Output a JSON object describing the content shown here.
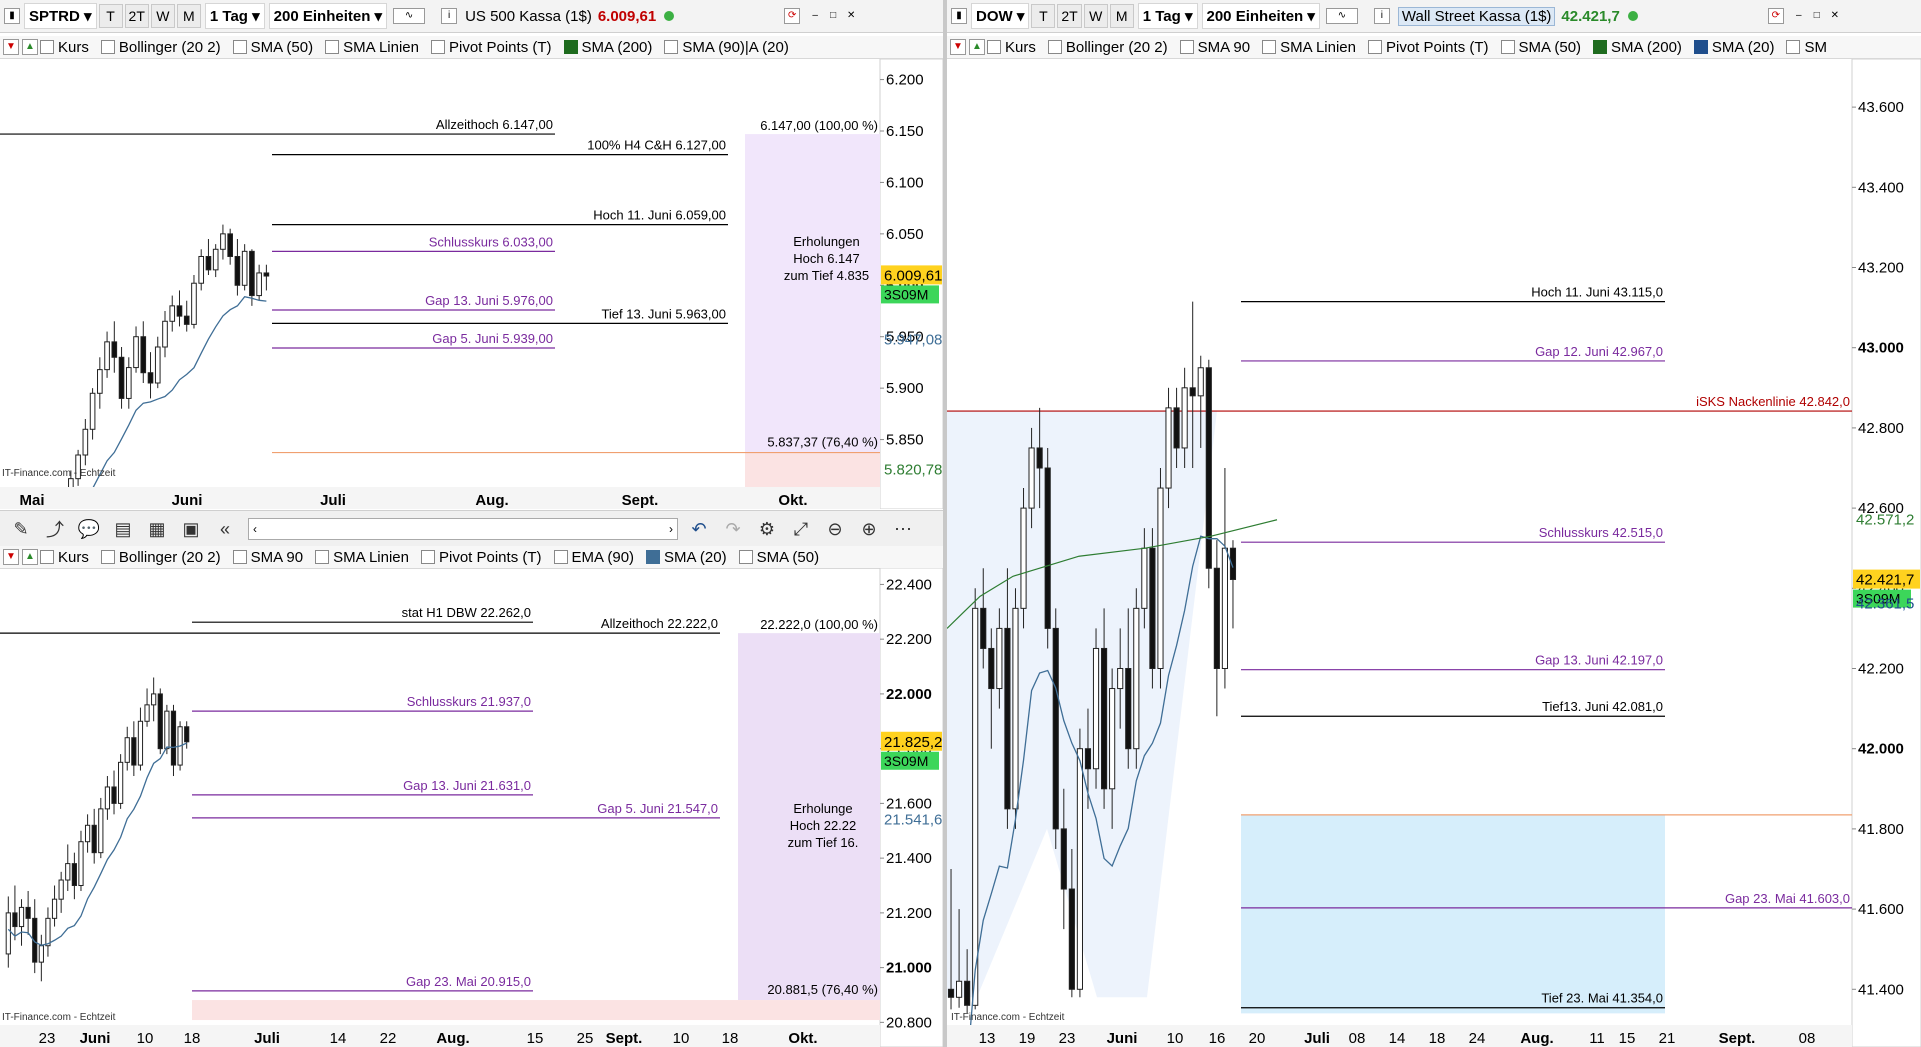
{
  "left_top": {
    "toolbar": {
      "symbol": "SPTRD",
      "periods": [
        "T",
        "2T",
        "W",
        "M"
      ],
      "interval": "1 Tag",
      "units": "200 Einheiten",
      "title": "US 500 Kassa (1$)",
      "price": "6.009,61"
    },
    "indicators": [
      "Kurs",
      "Bollinger (20 2)",
      "SMA (50)",
      "SMA Linien",
      "Pivot Points (T)",
      "SMA (200)",
      "SMA (90)|A (20)"
    ],
    "watermark": "IT-Finance.com - Echtzeit",
    "x_labels": [
      "Mai",
      "Juni",
      "Juli",
      "Aug.",
      "Sept.",
      "Okt."
    ]
  },
  "left_bottom": {
    "indicators": [
      "Kurs",
      "Bollinger (20 2)",
      "SMA 90",
      "SMA Linien",
      "Pivot Points (T)",
      "EMA (90)",
      "SMA (20)",
      "SMA (50)"
    ],
    "watermark": "IT-Finance.com - Echtzeit",
    "x_labels": [
      "23",
      "Juni",
      "10",
      "18",
      "Juli",
      "14",
      "22",
      "Aug.",
      "15",
      "25",
      "Sept.",
      "10",
      "18",
      "Okt."
    ]
  },
  "right": {
    "toolbar": {
      "symbol": "DOW",
      "periods": [
        "T",
        "2T",
        "W",
        "M"
      ],
      "interval": "1 Tag",
      "units": "200 Einheiten",
      "title": "Wall Street Kassa (1$)",
      "price": "42.421,7"
    },
    "indicators": [
      "Kurs",
      "Bollinger (20 2)",
      "SMA 90",
      "SMA Linien",
      "Pivot Points (T)",
      "SMA (50)",
      "SMA (200)",
      "SMA (20)",
      "SM"
    ],
    "watermark": "IT-Finance.com - Echtzeit",
    "x_labels": [
      "13",
      "19",
      "23",
      "Juni",
      "10",
      "16",
      "20",
      "Juli",
      "08",
      "14",
      "18",
      "24",
      "Aug.",
      "11",
      "15",
      "21",
      "Sept.",
      "08"
    ]
  },
  "chart_data": [
    {
      "type": "candlestick",
      "title": "US 500 Kassa (1$)",
      "ylim": [
        5800,
        6220
      ],
      "y_ticks": [
        "6.200",
        "6.150",
        "6.100",
        "6.050",
        "6.000",
        "5.950",
        "5.900",
        "5.850"
      ],
      "last_price": "6.009,61",
      "timer": "3S09M",
      "axis_markers": [
        "5.947,08",
        "5.820,78"
      ],
      "levels": [
        {
          "label": "Allzeithoch  6.147,00",
          "value": 6147,
          "color": "#000000"
        },
        {
          "label": "100% H4 C&H  6.127,00",
          "value": 6127,
          "color": "#000000"
        },
        {
          "label": "Hoch 11. Juni 6.059,00",
          "value": 6059,
          "color": "#000000"
        },
        {
          "label": "Schlusskurs 6.033,00",
          "value": 6033,
          "color": "#7a2a9e"
        },
        {
          "label": "Gap 13. Juni 5.976,00",
          "value": 5976,
          "color": "#7a2a9e"
        },
        {
          "label": "Tief 13. Juni 5.963,00",
          "value": 5963,
          "color": "#000000"
        },
        {
          "label": "Gap 5. Juni 5.939,00",
          "value": 5939,
          "color": "#7a2a9e"
        }
      ],
      "fib_labels": [
        "6.147,00 (100,00 %)",
        "5.837,37 (76,40 %)"
      ],
      "box_text": [
        "Erholungen",
        "Hoch 6.147",
        "zum Tief 4.835"
      ],
      "candles": [
        [
          5760,
          5790,
          5750,
          5785
        ],
        [
          5785,
          5820,
          5780,
          5812
        ],
        [
          5812,
          5840,
          5805,
          5835
        ],
        [
          5835,
          5870,
          5825,
          5860
        ],
        [
          5860,
          5900,
          5850,
          5895
        ],
        [
          5895,
          5930,
          5880,
          5918
        ],
        [
          5918,
          5955,
          5910,
          5945
        ],
        [
          5945,
          5965,
          5915,
          5930
        ],
        [
          5930,
          5940,
          5880,
          5890
        ],
        [
          5890,
          5930,
          5880,
          5920
        ],
        [
          5920,
          5960,
          5915,
          5950
        ],
        [
          5950,
          5965,
          5905,
          5915
        ],
        [
          5915,
          5935,
          5890,
          5905
        ],
        [
          5905,
          5950,
          5900,
          5940
        ],
        [
          5940,
          5975,
          5930,
          5965
        ],
        [
          5965,
          5990,
          5955,
          5980
        ],
        [
          5980,
          5995,
          5960,
          5970
        ],
        [
          5970,
          5985,
          5955,
          5962
        ],
        [
          5962,
          6010,
          5958,
          6002
        ],
        [
          6002,
          6035,
          5995,
          6028
        ],
        [
          6028,
          6045,
          6010,
          6015
        ],
        [
          6015,
          6040,
          6008,
          6035
        ],
        [
          6035,
          6059,
          6025,
          6050
        ],
        [
          6050,
          6055,
          6020,
          6028
        ],
        [
          6028,
          6045,
          5990,
          6000
        ],
        [
          6000,
          6040,
          5995,
          6033
        ],
        [
          6033,
          6035,
          5980,
          5990
        ],
        [
          5990,
          6020,
          5985,
          6012
        ],
        [
          6012,
          6020,
          5995,
          6009
        ]
      ]
    },
    {
      "type": "candlestick",
      "title": "",
      "ylim": [
        20780,
        22460
      ],
      "y_ticks": [
        "22.400",
        "22.200",
        "22.000",
        "21.800",
        "21.600",
        "21.400",
        "21.200",
        "21.000",
        "20.800"
      ],
      "last_price": "21.825,2",
      "timer": "3S09M",
      "axis_markers": [
        "21.541,6"
      ],
      "levels": [
        {
          "label": "stat H1 DBW 22.262,0",
          "value": 22262,
          "color": "#000000"
        },
        {
          "label": "Allzeithoch 22.222,0",
          "value": 22222,
          "color": "#000000"
        },
        {
          "label": "Schlusskurs 21.937,0",
          "value": 21937,
          "color": "#7a2a9e"
        },
        {
          "label": "Gap 13. Juni 21.631,0",
          "value": 21631,
          "color": "#7a2a9e"
        },
        {
          "label": "Gap 5. Juni 21.547,0",
          "value": 21547,
          "color": "#7a2a9e"
        },
        {
          "label": "Gap 23. Mai 20.915,0",
          "value": 20915,
          "color": "#7a2a9e"
        }
      ],
      "fib_labels": [
        "22.222,0 (100,00 %)",
        "20.881,5 (76,40 %)"
      ],
      "box_text": [
        "Erholunge",
        "Hoch 22.22",
        "zum Tief 16."
      ],
      "candles": [
        [
          21050,
          21260,
          21000,
          21200
        ],
        [
          21200,
          21300,
          21100,
          21150
        ],
        [
          21150,
          21250,
          21080,
          21220
        ],
        [
          21220,
          21280,
          21120,
          21180
        ],
        [
          21180,
          21250,
          20980,
          21020
        ],
        [
          21020,
          21120,
          20950,
          21080
        ],
        [
          21080,
          21220,
          21040,
          21180
        ],
        [
          21180,
          21300,
          21150,
          21250
        ],
        [
          21250,
          21350,
          21200,
          21320
        ],
        [
          21320,
          21450,
          21280,
          21380
        ],
        [
          21380,
          21420,
          21250,
          21300
        ],
        [
          21300,
          21500,
          21280,
          21460
        ],
        [
          21460,
          21560,
          21420,
          21520
        ],
        [
          21520,
          21580,
          21380,
          21420
        ],
        [
          21420,
          21620,
          21400,
          21580
        ],
        [
          21580,
          21700,
          21540,
          21660
        ],
        [
          21660,
          21720,
          21560,
          21600
        ],
        [
          21600,
          21780,
          21580,
          21750
        ],
        [
          21750,
          21880,
          21720,
          21840
        ],
        [
          21840,
          21900,
          21700,
          21740
        ],
        [
          21740,
          21950,
          21720,
          21900
        ],
        [
          21900,
          22020,
          21880,
          21960
        ],
        [
          21960,
          22060,
          21900,
          22000
        ],
        [
          22000,
          22020,
          21780,
          21800
        ],
        [
          21800,
          21960,
          21780,
          21937
        ],
        [
          21937,
          21960,
          21700,
          21740
        ],
        [
          21740,
          21900,
          21720,
          21880
        ],
        [
          21880,
          21900,
          21800,
          21825
        ]
      ]
    },
    {
      "type": "candlestick",
      "title": "Wall Street Kassa (1$)",
      "ylim": [
        41330,
        43720
      ],
      "y_ticks": [
        "43.600",
        "43.400",
        "43.200",
        "43.000",
        "42.800",
        "42.600",
        "42.400",
        "42.200",
        "42.000",
        "41.800",
        "41.600",
        "41.400"
      ],
      "last_price": "42.421,7",
      "timer": "3S09M",
      "axis_markers": [
        "42.571,2",
        "42.361,5"
      ],
      "levels": [
        {
          "label": "Hoch 11. Juni 43.115,0",
          "value": 43115,
          "color": "#000000"
        },
        {
          "label": "Gap 12. Juni 42.967,0",
          "value": 42967,
          "color": "#7a2a9e"
        },
        {
          "label": "iSKS Nackenlinie 42.842,0",
          "value": 42842,
          "color": "#b00000"
        },
        {
          "label": "Schlusskurs 42.515,0",
          "value": 42515,
          "color": "#7a2a9e"
        },
        {
          "label": "Gap 13. Juni 42.197,0",
          "value": 42197,
          "color": "#7a2a9e"
        },
        {
          "label": "Tief13. Juni 42.081,0",
          "value": 42081,
          "color": "#000000"
        },
        {
          "label": "Gap  23. Mai 41.603,0",
          "value": 41603,
          "color": "#7a2a9e"
        },
        {
          "label": "Tief  23. Mai 41.354,0",
          "value": 41354,
          "color": "#000000"
        }
      ],
      "candles": [
        [
          41400,
          41700,
          41350,
          41380
        ],
        [
          41380,
          41600,
          41354,
          41420
        ],
        [
          41420,
          41500,
          41340,
          41360
        ],
        [
          41360,
          42400,
          41350,
          42350
        ],
        [
          42350,
          42450,
          42200,
          42250
        ],
        [
          42250,
          42300,
          42000,
          42150
        ],
        [
          42150,
          42350,
          42100,
          42300
        ],
        [
          42300,
          42450,
          41800,
          41850
        ],
        [
          41850,
          42400,
          41800,
          42350
        ],
        [
          42350,
          42650,
          42300,
          42600
        ],
        [
          42600,
          42800,
          42550,
          42750
        ],
        [
          42750,
          42850,
          42600,
          42700
        ],
        [
          42700,
          42750,
          42250,
          42300
        ],
        [
          42300,
          42350,
          41750,
          41800
        ],
        [
          41800,
          41900,
          41550,
          41650
        ],
        [
          41650,
          41750,
          41380,
          41400
        ],
        [
          41400,
          42050,
          41380,
          42000
        ],
        [
          42000,
          42100,
          41850,
          41950
        ],
        [
          41950,
          42300,
          41900,
          42250
        ],
        [
          42250,
          42350,
          41850,
          41900
        ],
        [
          41900,
          42200,
          41800,
          42150
        ],
        [
          42150,
          42300,
          42050,
          42200
        ],
        [
          42200,
          42350,
          41950,
          42000
        ],
        [
          42000,
          42400,
          41950,
          42350
        ],
        [
          42350,
          42550,
          42300,
          42500
        ],
        [
          42500,
          42550,
          42150,
          42200
        ],
        [
          42200,
          42700,
          42150,
          42650
        ],
        [
          42650,
          42900,
          42600,
          42850
        ],
        [
          42850,
          42900,
          42700,
          42750
        ],
        [
          42750,
          42950,
          42700,
          42900
        ],
        [
          42900,
          43115,
          42700,
          42880
        ],
        [
          42880,
          42980,
          42750,
          42950
        ],
        [
          42950,
          42970,
          42400,
          42450
        ],
        [
          42450,
          42520,
          42081,
          42200
        ],
        [
          42200,
          42700,
          42150,
          42500
        ],
        [
          42500,
          42520,
          42300,
          42422
        ]
      ],
      "sma_band": [
        [
          0,
          42300
        ],
        [
          0.05,
          42340
        ],
        [
          0.1,
          42380
        ],
        [
          0.2,
          42430
        ],
        [
          0.4,
          42480
        ],
        [
          0.6,
          42500
        ],
        [
          0.8,
          42530
        ],
        [
          1,
          42571
        ]
      ]
    }
  ]
}
